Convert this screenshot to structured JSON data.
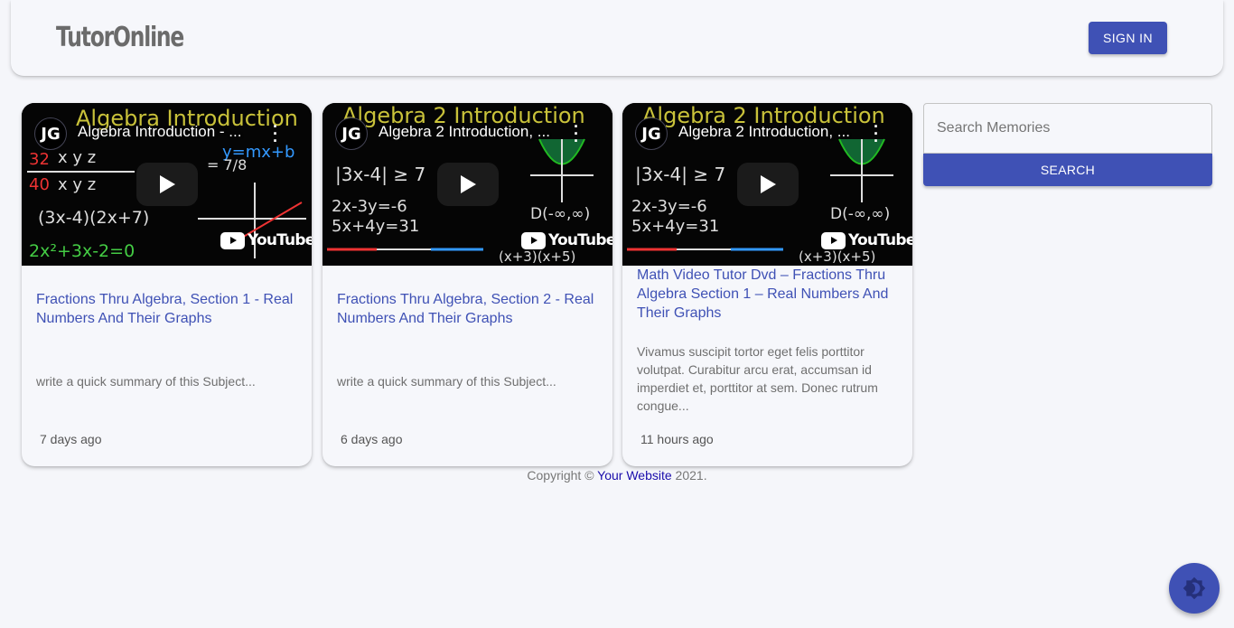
{
  "header": {
    "logo": "TutorOnline",
    "signin_label": "SIGN IN"
  },
  "cards": [
    {
      "video_title": "Algebra Introduction - ...",
      "channel": "JG",
      "youtube_label": "YouTube",
      "title": "Fractions Thru Algebra, Section 1 - Real Numbers And Their Graphs",
      "summary": "write a quick summary of this Subject...",
      "time": "7 days ago"
    },
    {
      "video_title": "Algebra 2 Introduction, ...",
      "channel": "JG",
      "youtube_label": "YouTube",
      "title": "Fractions Thru Algebra, Section 2 - Real Numbers And Their Graphs",
      "summary": "write a quick summary of this Subject...",
      "time": "6 days ago"
    },
    {
      "video_title": "Algebra 2 Introduction, ...",
      "channel": "JG",
      "youtube_label": "YouTube",
      "title": "Math Video Tutor Dvd – Fractions Thru Algebra Section 1 – Real Numbers And Their Graphs",
      "summary": "Vivamus suscipit tortor eget felis porttitor volutpat. Curabitur arcu erat, accumsan id imperdiet et, porttitor at sem. Donec rutrum congue...",
      "time": "11 hours ago"
    }
  ],
  "search": {
    "placeholder": "Search Memories",
    "button_label": "SEARCH"
  },
  "footer": {
    "prefix": "Copyright ©",
    "link_text": "Your Website",
    "suffix": "2021."
  },
  "colors": {
    "primary": "#3f51b5",
    "background": "#f5f6fa"
  },
  "icons": {
    "theme_toggle": "brightness-icon",
    "play": "play-icon"
  }
}
